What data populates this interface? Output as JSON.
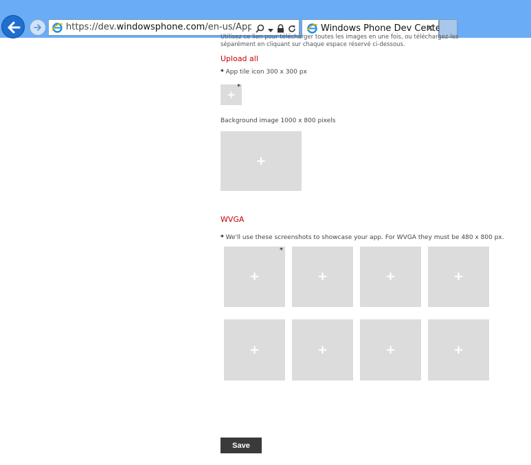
{
  "browser": {
    "address_prefix": "https://dev.",
    "address_domain": "windowsphone.com",
    "address_rest": "/en-us/AppSubmis",
    "tab_title": "Windows Phone Dev Center",
    "tab_close": "✕"
  },
  "page": {
    "intro_text": "Utilisez ce lien pour télécharger toutes les images en une fois, ou téléchargez-les séparément en cliquant sur chaque espace réservé ci-dessous.",
    "upload_all_link": "Upload all",
    "app_tile_label": "App tile icon 300 x 300 px",
    "required_star": "*",
    "background_label": "Background image 1000 x 800 pixels",
    "wvga_heading": "WVGA",
    "screenshots_label": "We'll use these screenshots to showcase your app. For WVGA they must be 480 x 800 px.",
    "plus_glyph": "+",
    "save_label": "Save"
  }
}
